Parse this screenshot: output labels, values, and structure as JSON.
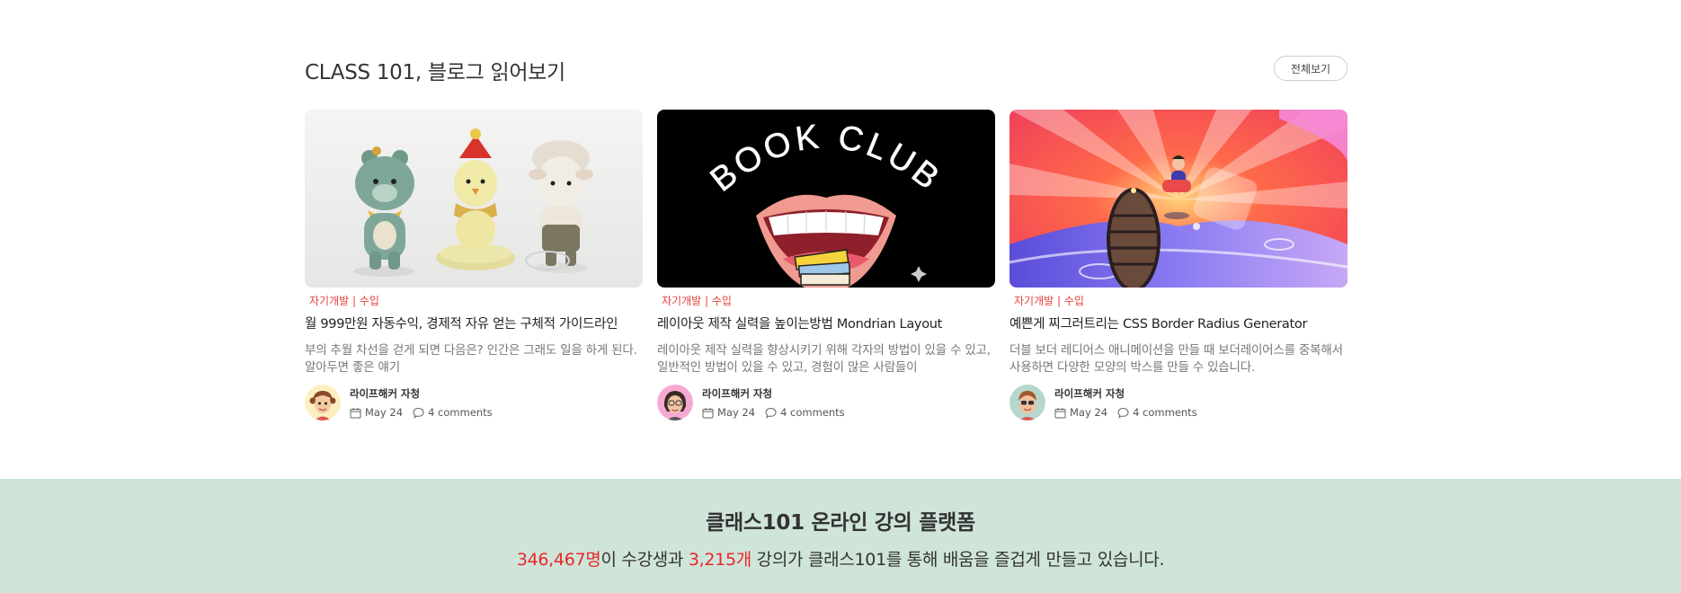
{
  "section": {
    "title": "CLASS 101, 블로그 읽어보기",
    "view_all_label": "전체보기"
  },
  "posts": [
    {
      "category": "자기개발 | 수입",
      "title": "월 999만원 자동수익, 경제적 자유 얻는 구체적 가이드라인",
      "excerpt": "부의 추월 차선을 걷게 되면 다음은? 인간은 그래도 일을 하게 된다. 알아두면 좋은 얘기",
      "author": "라이프해커 자청",
      "date": "May 24",
      "comments": "4 comments",
      "thumbnail_icon": "crochet-dolls-image",
      "avatar_icon": "avatar-1-icon"
    },
    {
      "category": "자기개발 | 수입",
      "title": "레이아웃 제작 실력을 높이는방법 Mondrian Layout",
      "excerpt": "레이아웃 제작 실력을 향상시키기 위해 각자의 방법이 있을 수 있고, 일반적인 방법이 있을 수 있고, 경험이 많은 사람들이",
      "author": "라이프해커 자청",
      "date": "May 24",
      "comments": "4 comments",
      "thumbnail_icon": "book-club-image",
      "thumbnail_text": "BOOK CLUB",
      "avatar_icon": "avatar-2-icon"
    },
    {
      "category": "자기개발 | 수입",
      "title": "예쁜게 찌그러트리는 CSS Border Radius Generator",
      "excerpt": "더블 보더 레디어스 애니메이션을 만들 때 보더레이어스를 중복해서 사용하면 다양한 모양의 박스를 만들 수 있습니다.",
      "author": "라이프해커 자청",
      "date": "May 24",
      "comments": "4 comments",
      "thumbnail_icon": "colorful-portal-illustration-image",
      "avatar_icon": "avatar-3-icon"
    }
  ],
  "stats": {
    "title": "클래스101 온라인 강의 플랫폼",
    "students_count": "346,467명",
    "students_suffix": "이 수강생과 ",
    "classes_count": "3,215개",
    "classes_suffix": " 강의가 클래스101를 통해 배움을 즐겁게 만들고 있습니다."
  },
  "colors": {
    "accent": "#e8413b",
    "highlight": "#e8272c",
    "stats_background": "#cfe5d9"
  }
}
